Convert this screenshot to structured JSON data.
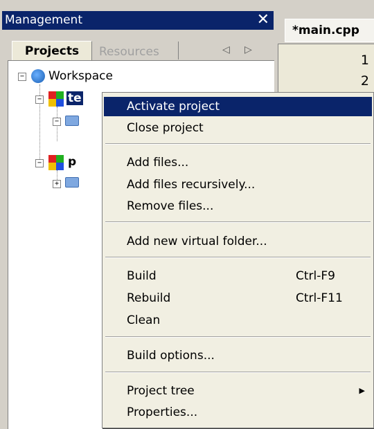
{
  "panel": {
    "title": "Management",
    "close_glyph": "✕",
    "tabs": [
      {
        "label": "Projects",
        "active": true
      },
      {
        "label": "Resources",
        "active": false
      }
    ],
    "nav_left": "◁",
    "nav_right": "▷"
  },
  "tree": {
    "workspace_label": "Workspace",
    "project1_label": "te",
    "project2_label": "p"
  },
  "editor": {
    "tab_label": "*main.cpp",
    "line_numbers": [
      "1",
      "2"
    ]
  },
  "context_menu": {
    "items": [
      {
        "label": "Activate project",
        "selected": true
      },
      {
        "label": "Close project"
      },
      {
        "label": "Add files..."
      },
      {
        "label": "Add files recursively..."
      },
      {
        "label": "Remove files..."
      },
      {
        "label": "Add new virtual folder..."
      },
      {
        "label": "Build",
        "shortcut": "Ctrl-F9"
      },
      {
        "label": "Rebuild",
        "shortcut": "Ctrl-F11"
      },
      {
        "label": "Clean"
      },
      {
        "label": "Build options..."
      },
      {
        "label": "Project tree",
        "submenu_glyph": "▶"
      },
      {
        "label": "Properties..."
      }
    ]
  },
  "colors": {
    "selection": "#0a246a",
    "menu_bg": "#f1efe2",
    "panel_bg": "#d4d0c8"
  }
}
